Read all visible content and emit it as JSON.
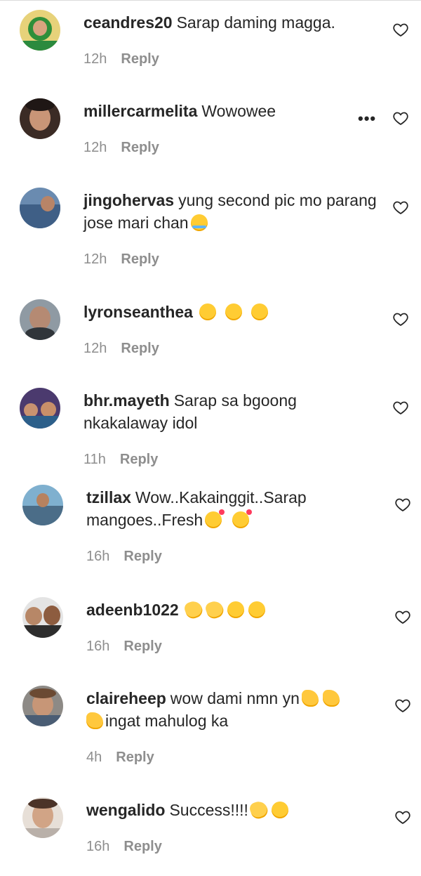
{
  "comments": [
    {
      "username": "ceandres20",
      "text": "Sarap daming magga.",
      "time": "12h",
      "reply": "Reply",
      "emojis": []
    },
    {
      "username": "millercarmelita",
      "text": "Wowowee",
      "time": "12h",
      "reply": "Reply",
      "emojis": [],
      "more": "•••"
    },
    {
      "username": "jingohervas",
      "text": "yung second pic mo parang jose mari chan",
      "time": "12h",
      "reply": "Reply",
      "emojis": [
        "tears-of-joy-emoji"
      ]
    },
    {
      "username": "lyronseanthea",
      "text": "",
      "time": "12h",
      "reply": "Reply",
      "emojis": [
        "relieved-face-emoji",
        "relieved-face-emoji",
        "relieved-face-emoji"
      ]
    },
    {
      "username": "bhr.mayeth",
      "text": "Sarap sa bgoong nkakalaway idol",
      "time": "11h",
      "reply": "Reply",
      "emojis": []
    },
    {
      "username": "tzillax",
      "text": "Wow..Kakainggit..Sarap mangoes..Fresh",
      "time": "16h",
      "reply": "Reply",
      "emojis": [
        "smiling-face-with-hearts-emoji",
        "smiling-face-with-hearts-emoji"
      ]
    },
    {
      "username": "adeenb1022",
      "text": "",
      "time": "16h",
      "reply": "Reply",
      "emojis": [
        "clapping-hands-emoji",
        "clapping-hands-emoji",
        "smiling-face-emoji",
        "smiling-face-emoji"
      ]
    },
    {
      "username": "claireheep",
      "text": "wow dami nmn yn",
      "text2": "ingat mahulog ka",
      "time": "4h",
      "reply": "Reply",
      "emojis": [
        "thumbs-up-emoji",
        "thumbs-up-emoji",
        "thumbs-up-emoji"
      ]
    },
    {
      "username": "wengalido",
      "text": "Success!!!!",
      "time": "16h",
      "reply": "Reply",
      "emojis": [
        "clapping-hands-emoji",
        "grinning-face-emoji"
      ]
    }
  ],
  "icons": {
    "heart": "heart-outline-icon",
    "more": "more-options-icon"
  },
  "colors": {
    "text": "#262626",
    "meta": "#8e8e8e"
  }
}
